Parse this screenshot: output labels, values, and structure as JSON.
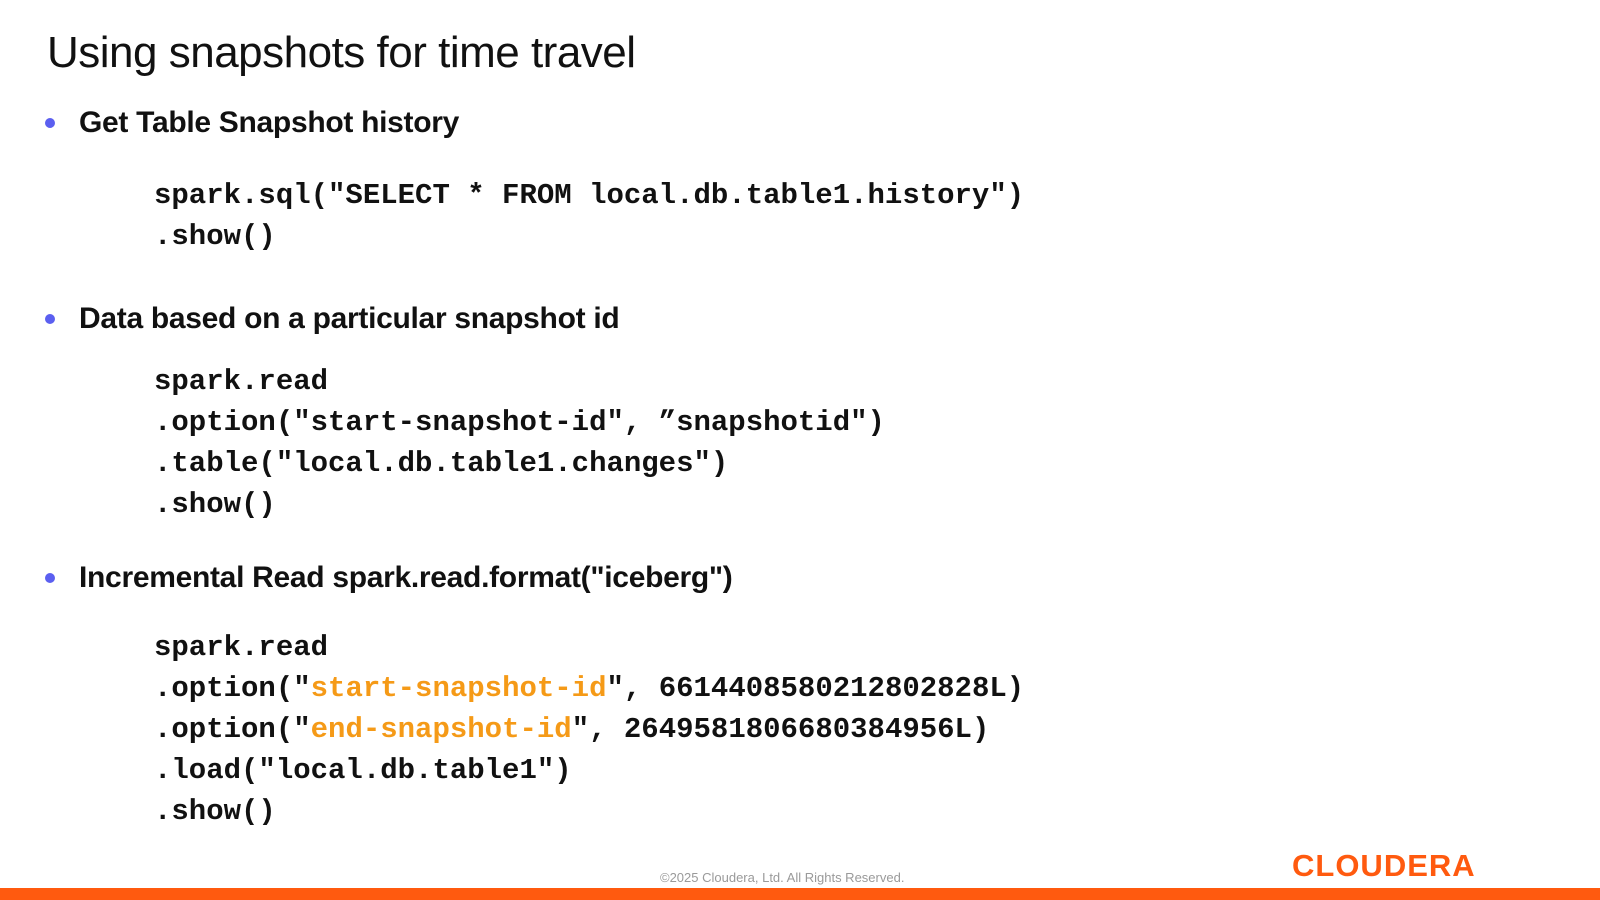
{
  "slide": {
    "title": "Using snapshots for time travel"
  },
  "colors": {
    "bullet": "#5b5ff0",
    "highlight": "#f59a17",
    "brand": "#ff5a0f",
    "text": "#111111"
  },
  "sections": [
    {
      "heading": "Get Table Snapshot history",
      "code": [
        "spark.sql(\"SELECT * FROM local.db.table1.history\")",
        ".show()"
      ]
    },
    {
      "heading": "Data based on a particular snapshot id",
      "code": [
        "spark.read",
        ".option(\"start-snapshot-id\", ”snapshotid\")",
        ".table(\"local.db.table1.changes\")",
        ".show()"
      ]
    },
    {
      "heading": "Incremental Read spark.read.format(\"iceberg\")",
      "code": {
        "line1": "spark.read",
        "line2": {
          "before": ".option(\"",
          "highlight": "start-snapshot-id",
          "after": "\", 6614408580212802828L)"
        },
        "line3": {
          "before": ".option(\"",
          "highlight": "end-snapshot-id",
          "after": "\", 2649581806680384956L)"
        },
        "line4": ".load(\"local.db.table1\")",
        "line5": ".show()"
      }
    }
  ],
  "footer": {
    "copyright": "©2025 Cloudera, Ltd. All Rights Reserved.",
    "logo_text": "CLOUDERA"
  }
}
